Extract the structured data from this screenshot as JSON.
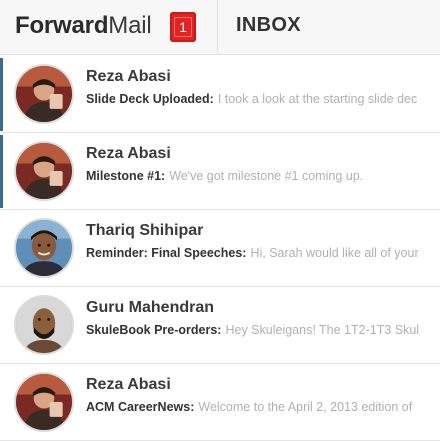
{
  "app": {
    "brand_bold": "Forward",
    "brand_light": "Mail",
    "unread_count": "1",
    "folder_title": "INBOX"
  },
  "messages": [
    {
      "sender": "Reza Abasi",
      "subject": "Slide Deck Uploaded:",
      "preview": "I took a look at the starting slide dec",
      "unread": true,
      "avatar": "reza"
    },
    {
      "sender": "Reza Abasi",
      "subject": "Milestone #1:",
      "preview": "We've got milestone #1 coming up.",
      "unread": true,
      "avatar": "reza"
    },
    {
      "sender": "Thariq Shihipar",
      "subject": "Reminder: Final Speeches:",
      "preview": "Hi, Sarah would like all of your",
      "unread": false,
      "avatar": "thariq"
    },
    {
      "sender": "Guru Mahendran",
      "subject": "SkuleBook Pre-orders:",
      "preview": "Hey Skuleigans! The 1T2-1T3 Skul",
      "unread": false,
      "avatar": "guru"
    },
    {
      "sender": "Reza Abasi",
      "subject": "ACM CareerNews:",
      "preview": "Welcome to the April 2, 2013 edition of",
      "unread": false,
      "avatar": "reza"
    }
  ],
  "colors": {
    "accent_bar": "#3b6b8e",
    "badge": "#e32222",
    "preview_text": "#b0b0b0"
  }
}
